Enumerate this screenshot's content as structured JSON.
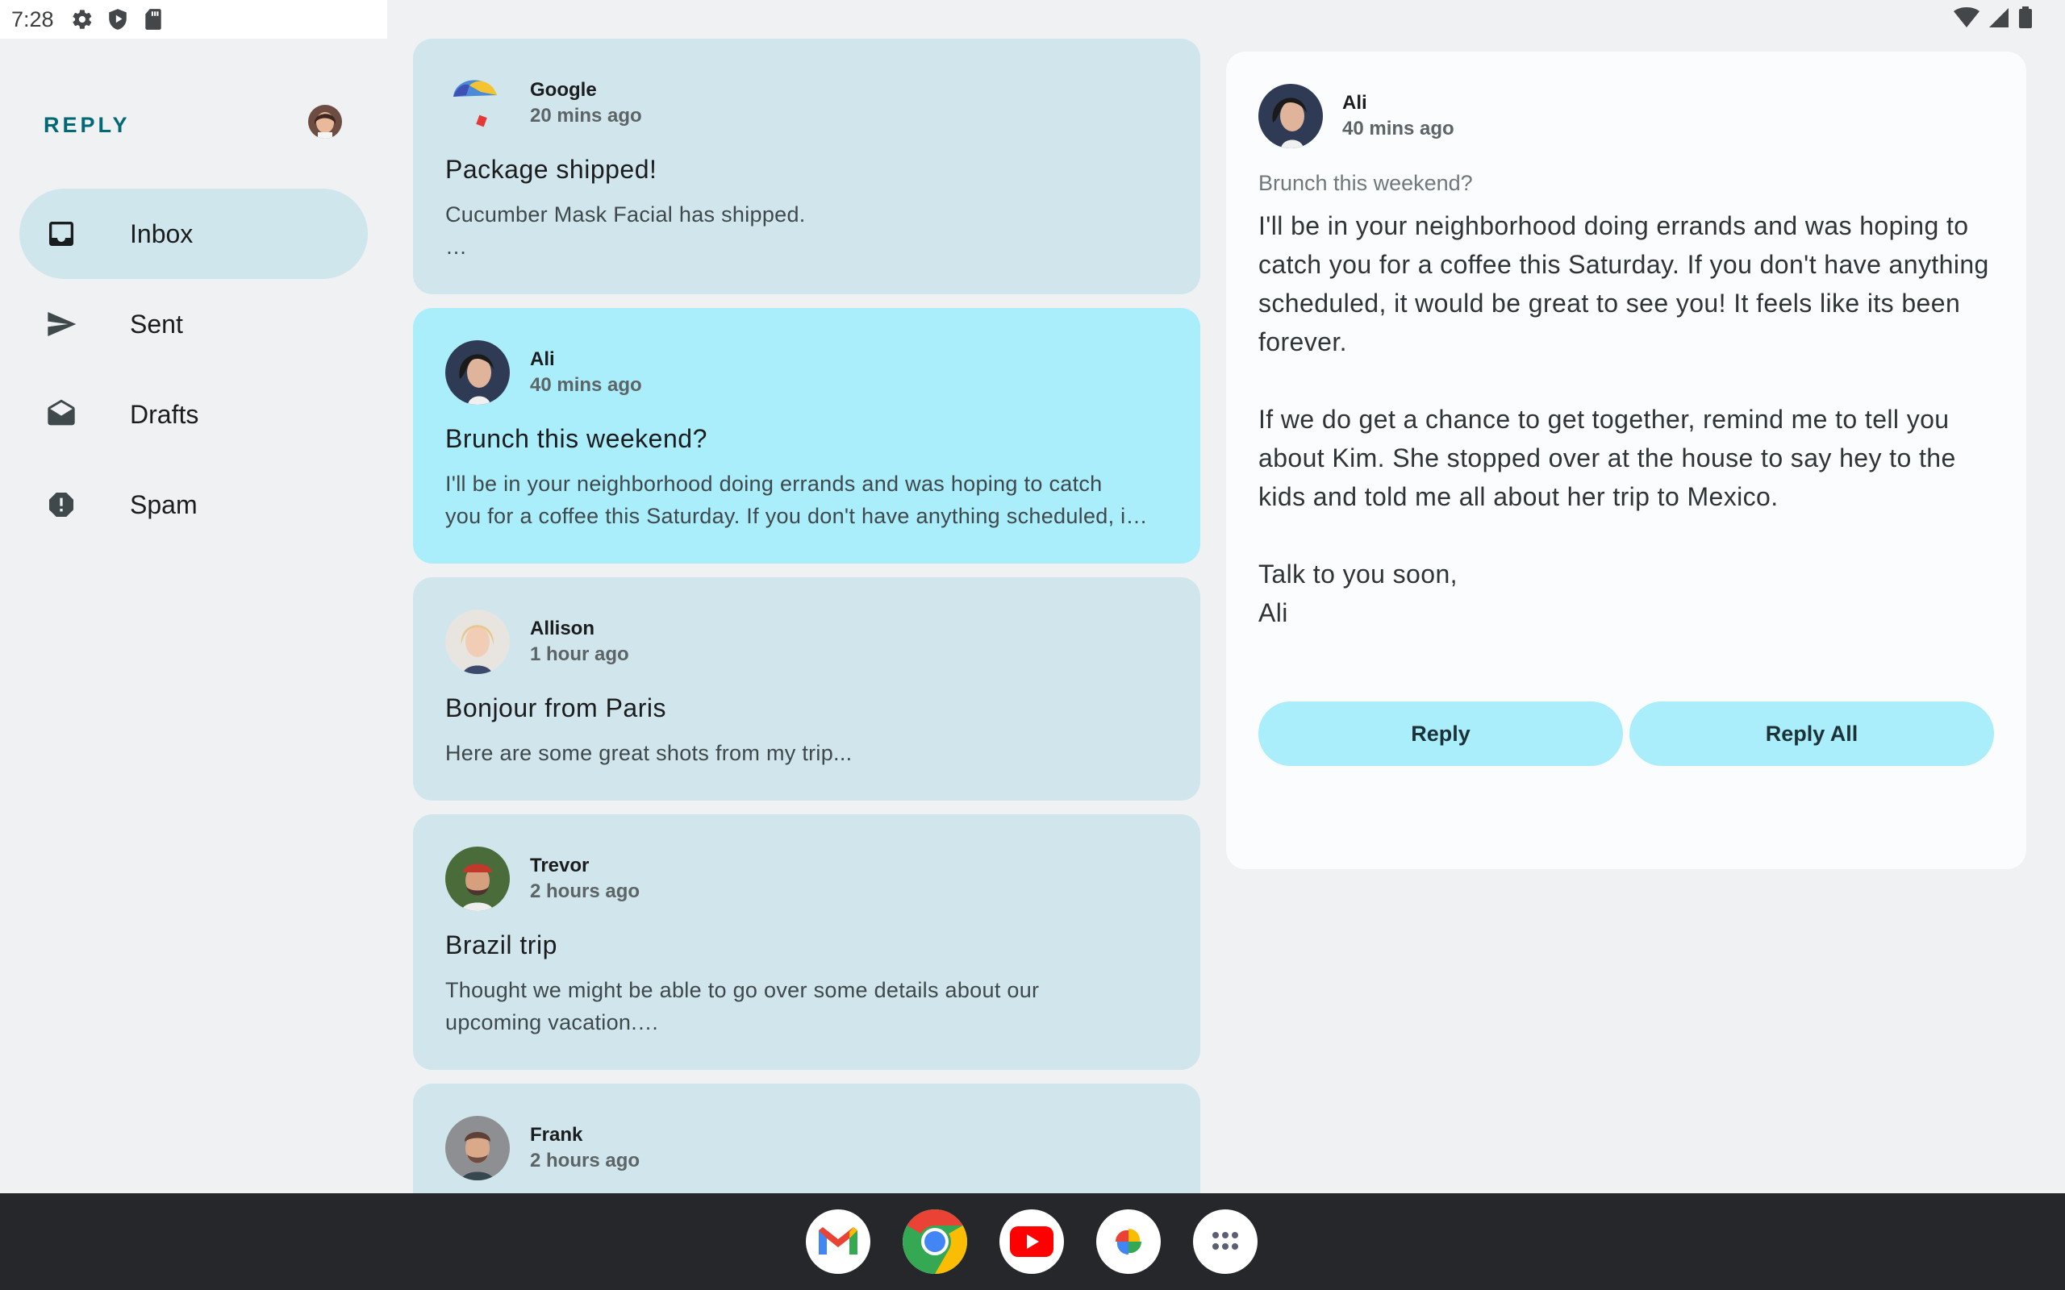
{
  "status_bar": {
    "time": "7:28",
    "left_icons": [
      "gear-icon",
      "shield-play-icon",
      "sd-card-icon"
    ],
    "right_icons": [
      "wifi-icon",
      "cell-signal-icon",
      "battery-icon"
    ]
  },
  "nav": {
    "brand": "REPLY",
    "items": [
      {
        "label": "Inbox",
        "icon": "inbox-icon",
        "active": true
      },
      {
        "label": "Sent",
        "icon": "send-icon",
        "active": false
      },
      {
        "label": "Drafts",
        "icon": "drafts-icon",
        "active": false
      },
      {
        "label": "Spam",
        "icon": "report-icon",
        "active": false
      }
    ]
  },
  "emails": [
    {
      "sender": "Google",
      "time": "20 mins ago",
      "subject": "Package shipped!",
      "preview_lines": [
        "Cucumber Mask Facial has shipped.",
        "…"
      ]
    },
    {
      "sender": "Ali",
      "time": "40 mins ago",
      "subject": "Brunch this weekend?",
      "preview_lines": [
        "I'll be in your neighborhood doing errands and was hoping to catch",
        "you for a coffee this Saturday. If you don't have anything scheduled, i…"
      ],
      "selected": true
    },
    {
      "sender": "Allison",
      "time": "1 hour ago",
      "subject": "Bonjour from Paris",
      "preview_lines": [
        "Here are some great shots from my trip..."
      ]
    },
    {
      "sender": "Trevor",
      "time": "2 hours ago",
      "subject": "Brazil trip",
      "preview_lines": [
        "Thought we might be able to go over some details about our",
        "upcoming vacation.…"
      ]
    },
    {
      "sender": "Frank",
      "time": "2 hours ago",
      "subject": "",
      "preview_lines": []
    }
  ],
  "detail": {
    "sender": "Ali",
    "time": "40 mins ago",
    "subject": "Brunch this weekend?",
    "paragraphs": [
      "I'll be in your neighborhood doing errands and was hoping to catch you for a coffee this Saturday. If you don't have anything scheduled, it would be great to see you! It feels like its been forever.",
      "If we do get a chance to get together, remind me to tell you about Kim. She stopped over at the house to say hey to the kids and told me all about her trip to Mexico.",
      "Talk to you soon,",
      "Ali"
    ],
    "reply_label": "Reply",
    "reply_all_label": "Reply All"
  },
  "taskbar": {
    "apps": [
      "gmail-icon",
      "chrome-icon",
      "youtube-icon",
      "photos-icon",
      "app-drawer-icon"
    ]
  },
  "colors": {
    "accent": "#006876",
    "card": "#d0e6ec",
    "card_selected": "#aaedfb",
    "nav_active": "#cfe6ec",
    "background": "#eff1f2",
    "taskbar": "#25272a"
  }
}
